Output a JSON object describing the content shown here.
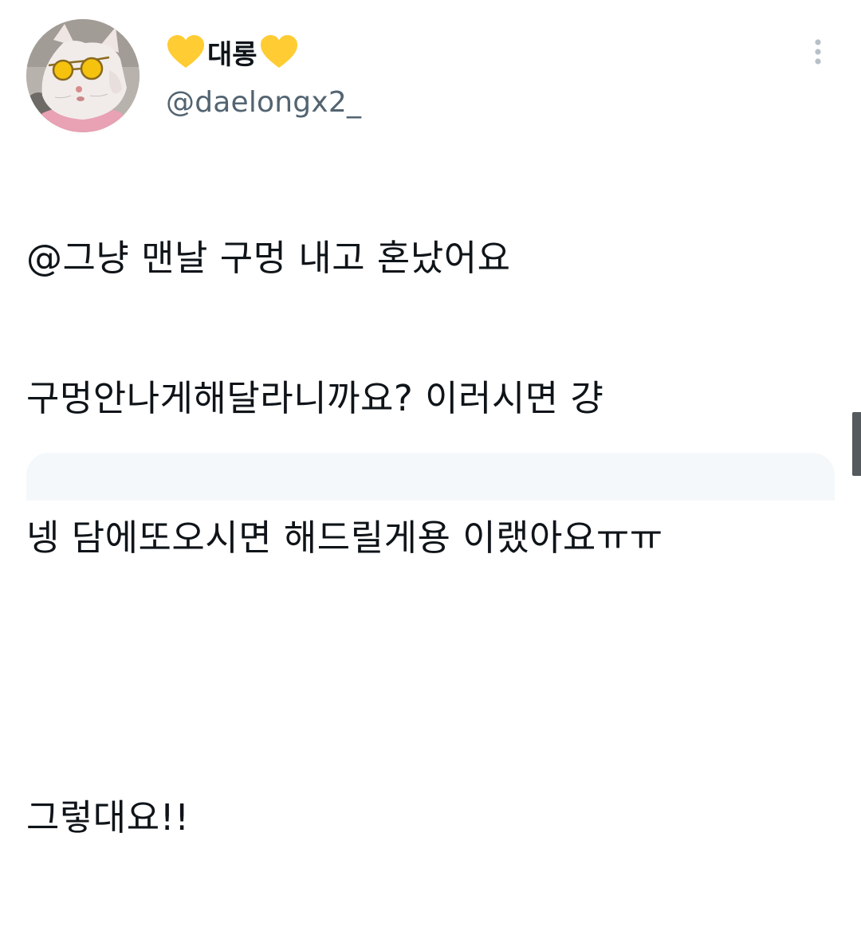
{
  "tweet": {
    "author": {
      "display_name": "대롱",
      "name_decoration_icon": "yellow-heart-icon",
      "handle": "@daelongx2_",
      "avatar_icon": "cat-with-sunglasses-avatar"
    },
    "more_icon": "vertical-ellipsis-icon",
    "text_lines": [
      "@그냥 맨날 구멍 내고 혼났어요",
      "구멍안나게해달라니까요? 이러시면 걍",
      "넹 담에또오시면 해드릴게용 이랬아요ㅠㅠ",
      "",
      "그렇대요!!"
    ]
  },
  "colors": {
    "text": "#0f1419",
    "secondary_text": "#536471",
    "heart": "#ffcc33",
    "card_background": "#f5f8fa"
  }
}
